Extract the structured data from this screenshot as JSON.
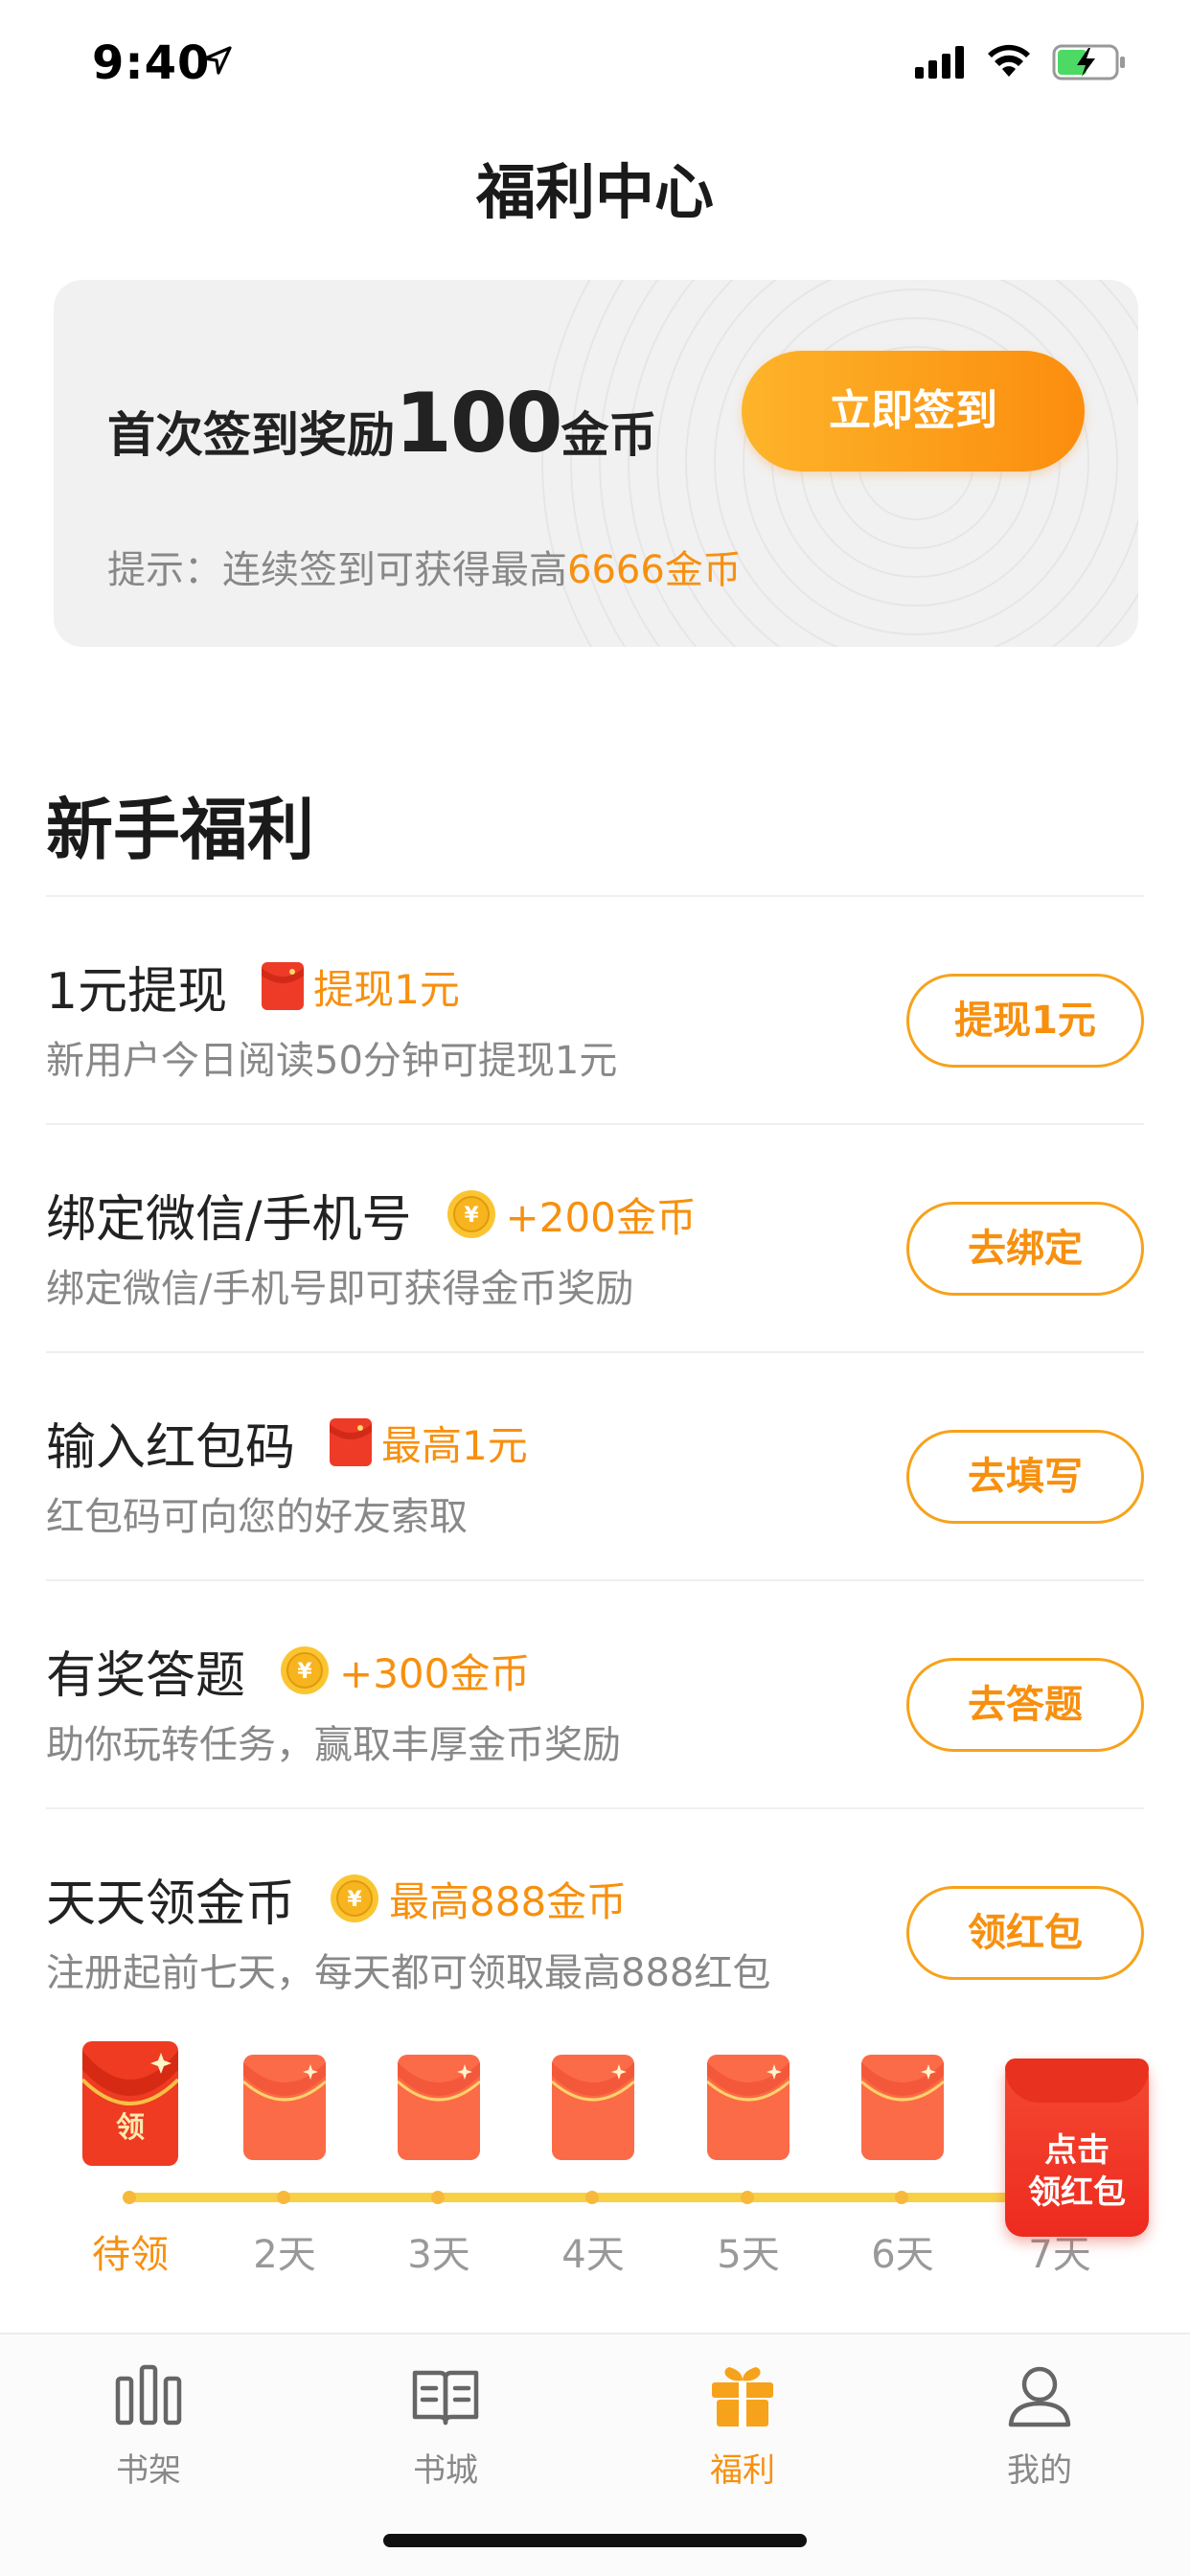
{
  "status_bar": {
    "time": "9:40"
  },
  "header": {
    "title": "福利中心"
  },
  "sign_card": {
    "headline_pre": "首次签到奖励",
    "headline_num": "100",
    "headline_post": "金币",
    "button": "立即签到",
    "tip_pre": "提示：连续签到可获得最高",
    "tip_highlight": "6666金币"
  },
  "section": {
    "title": "新手福利"
  },
  "tasks": [
    {
      "title": "1元提现",
      "reward_icon": "red-envelope-icon",
      "reward": "提现1元",
      "subtitle": "新用户今日阅读50分钟可提现1元",
      "button": "提现1元"
    },
    {
      "title": "绑定微信/手机号",
      "reward_icon": "coin-icon",
      "reward": "+200金币",
      "subtitle": "绑定微信/手机号即可获得金币奖励",
      "button": "去绑定"
    },
    {
      "title": "输入红包码",
      "reward_icon": "red-envelope-icon",
      "reward": "最高1元",
      "subtitle": "红包码可向您的好友索取",
      "button": "去填写"
    },
    {
      "title": "有奖答题",
      "reward_icon": "coin-icon",
      "reward": "+300金币",
      "subtitle": "助你玩转任务，赢取丰厚金币奖励",
      "button": "去答题"
    },
    {
      "title": "天天领金币",
      "reward_icon": "coin-icon",
      "reward": "最高888金币",
      "subtitle": "注册起前七天，每天都可领取最高888红包",
      "button": "领红包"
    }
  ],
  "days": [
    {
      "label": "待领",
      "envelope_text": "领",
      "active": true
    },
    {
      "label": "2天",
      "active": false
    },
    {
      "label": "3天",
      "active": false
    },
    {
      "label": "4天",
      "active": false
    },
    {
      "label": "5天",
      "active": false
    },
    {
      "label": "6天",
      "active": false
    },
    {
      "label": "7天",
      "active": false
    }
  ],
  "floating_red_packet": {
    "line1": "点击",
    "line2": "领红包"
  },
  "tab_bar": {
    "tabs": [
      {
        "label": "书架",
        "icon": "bookshelf-icon",
        "active": false
      },
      {
        "label": "书城",
        "icon": "book-open-icon",
        "active": false
      },
      {
        "label": "福利",
        "icon": "gift-icon",
        "active": true
      },
      {
        "label": "我的",
        "icon": "person-icon",
        "active": false
      }
    ]
  },
  "colors": {
    "accent": "#f7900f",
    "button_gradient_start": "#fdb42a",
    "button_gradient_end": "#fc8d0e",
    "red": "#ee2a1f",
    "progress_line": "#f8d046"
  }
}
